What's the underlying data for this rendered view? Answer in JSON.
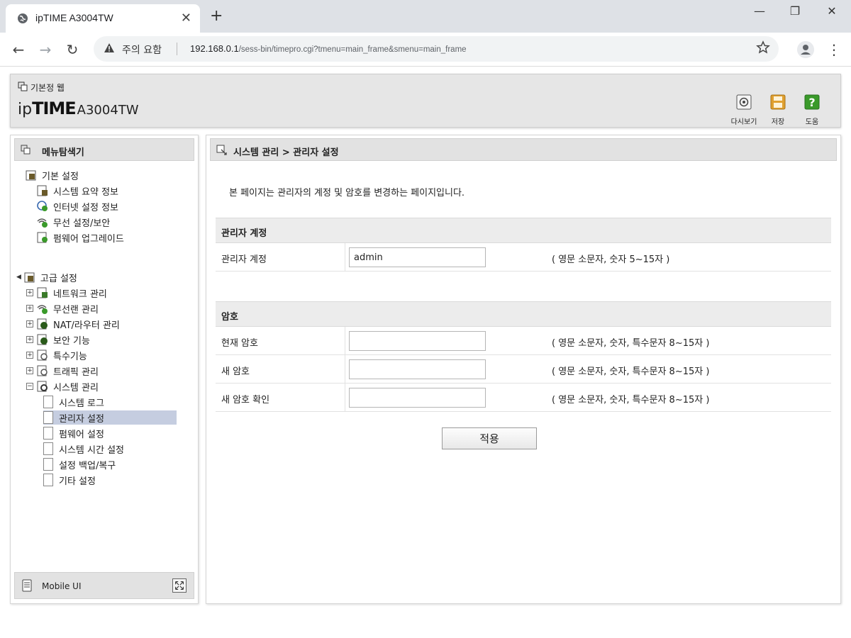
{
  "browser": {
    "tab_title": "ipTIME A3004TW",
    "tab_close": "✕",
    "new_tab": "+",
    "security_label": "주의 요함",
    "url_host": "192.168.0.1",
    "url_path": "/sess-bin/timepro.cgi?tmenu=main_frame&smenu=main_frame",
    "window_controls": {
      "minimize": "—",
      "maximize": "❐",
      "close": "✕"
    },
    "nav": {
      "back": "←",
      "forward": "→",
      "reload": "↻"
    }
  },
  "header": {
    "home_label": "기본정 웹",
    "brand_ip": "ip",
    "brand_time": "TIME",
    "brand_model": "A3004TW",
    "tools": [
      {
        "label": "다시보기",
        "icon": "refresh-icon"
      },
      {
        "label": "저장",
        "icon": "save-icon"
      },
      {
        "label": "도움",
        "icon": "help-icon"
      }
    ]
  },
  "sidebar": {
    "title": "메뉴탐색기",
    "basic": {
      "label": "기본 설정",
      "items": [
        "시스템 요약 정보",
        "인터넷 설정 정보",
        "무선 설정/보안",
        "펌웨어 업그레이드"
      ]
    },
    "advanced": {
      "label": "고급 설정",
      "groups": [
        "네트워크 관리",
        "무선랜 관리",
        "NAT/라우터 관리",
        "보안 기능",
        "특수기능",
        "트래픽 관리"
      ],
      "system": {
        "label": "시스템 관리",
        "items": [
          "시스템 로그",
          "관리자 설정",
          "펌웨어 설정",
          "시스템 시간 설정",
          "설정 백업/복구",
          "기타 설정"
        ],
        "selected": "관리자 설정"
      }
    },
    "footer_label": "Mobile UI"
  },
  "main": {
    "title": "시스템 관리 > 관리자 설정",
    "description": "본 페이지는 관리자의 계정 및 암호를 변경하는 페이지입니다.",
    "account_section": {
      "title": "관리자 계정",
      "label": "관리자 계정",
      "value": "admin",
      "hint": "( 영문 소문자, 숫자 5~15자 )"
    },
    "password_section": {
      "title": "암호",
      "current_label": "현재 암호",
      "current_hint": "( 영문 소문자, 숫자, 특수문자 8~15자 )",
      "new_label": "새 암호",
      "new_hint": "( 영문 소문자, 숫자, 특수문자 8~15자 )",
      "confirm_label": "새 암호 확인",
      "confirm_hint": "( 영문 소문자, 숫자, 특수문자 8~15자 )"
    },
    "apply_label": "적용"
  },
  "colors": {
    "selected_row": "#c5cde0",
    "panel_header": "#e2e2e2",
    "save_icon": "#e0a030",
    "help_icon": "#3a9a2a"
  }
}
